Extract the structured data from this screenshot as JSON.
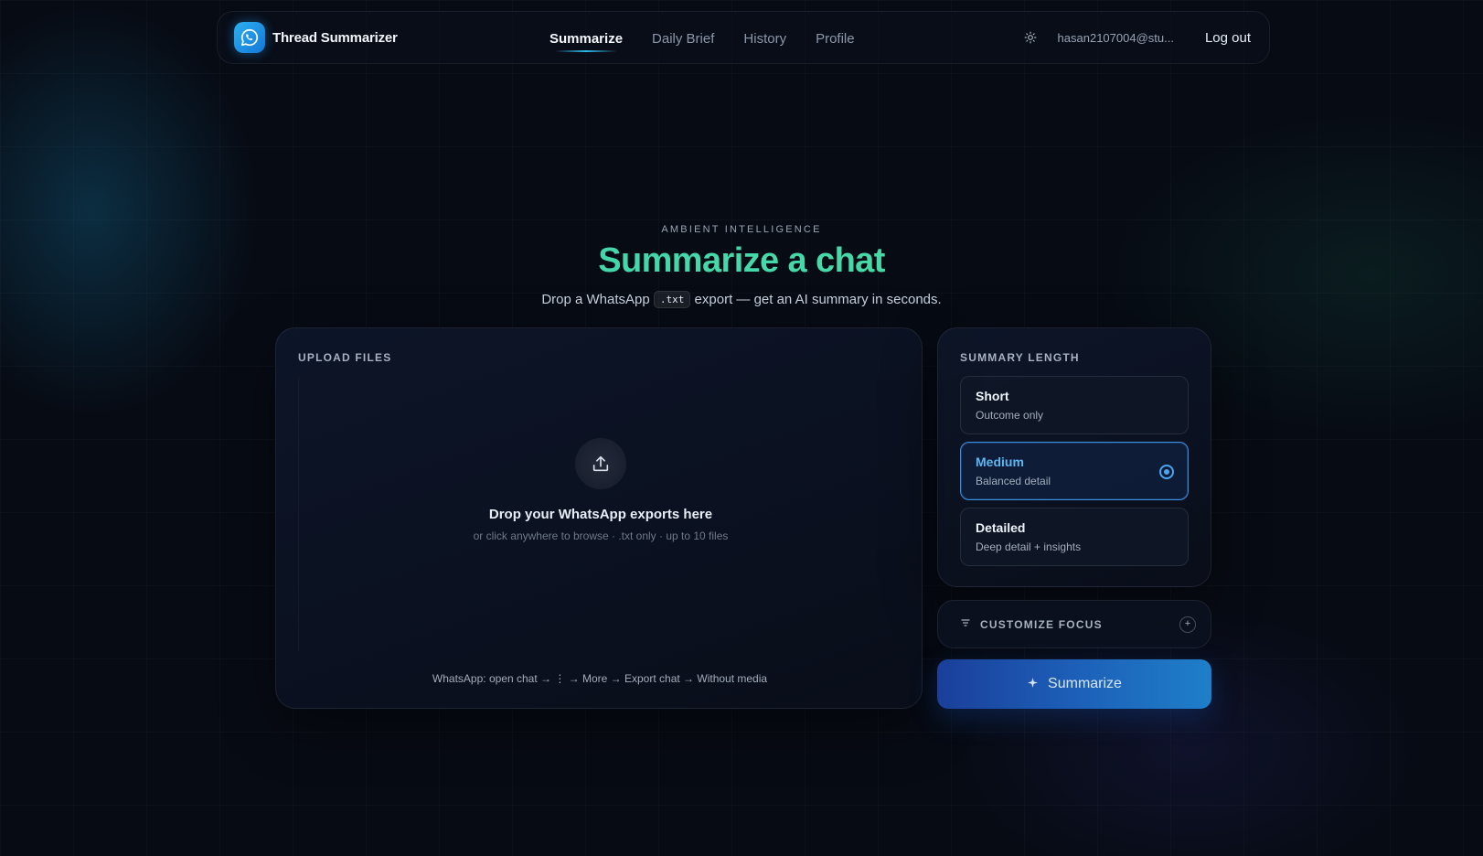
{
  "app": {
    "name": "Thread Summarizer"
  },
  "nav": {
    "links": [
      {
        "label": "Summarize",
        "active": true
      },
      {
        "label": "Daily Brief",
        "active": false
      },
      {
        "label": "History",
        "active": false
      },
      {
        "label": "Profile",
        "active": false
      }
    ],
    "user_email": "hasan2107004@stu...",
    "logout_label": "Log out"
  },
  "hero": {
    "eyebrow": "AMBIENT INTELLIGENCE",
    "title": "Summarize a chat",
    "subtitle_before": "Drop a WhatsApp",
    "subtitle_code": ".txt",
    "subtitle_after": "export — get an AI summary in seconds."
  },
  "upload": {
    "section_label": "UPLOAD FILES",
    "drop_title": "Drop your WhatsApp exports here",
    "drop_subtitle": "or click anywhere to browse · .txt only · up to 10 files",
    "hint": "WhatsApp: open chat → ⋮ → More → Export chat → Without media"
  },
  "summary_length": {
    "section_label": "SUMMARY LENGTH",
    "options": [
      {
        "title": "Short",
        "description": "Outcome only",
        "selected": false
      },
      {
        "title": "Medium",
        "description": "Balanced detail",
        "selected": true
      },
      {
        "title": "Detailed",
        "description": "Deep detail + insights",
        "selected": false
      }
    ]
  },
  "customize_focus": {
    "label": "CUSTOMIZE FOCUS",
    "plus": "+"
  },
  "summarize_button": {
    "label": "Summarize"
  },
  "colors": {
    "accent_blue": "#4aa6ee",
    "title_green": "#3fd0b0",
    "background": "#070b14"
  },
  "icons": {
    "logo": "whatsapp-icon",
    "theme": "sun-icon",
    "upload": "upload-icon",
    "focus": "sliders-icon",
    "summarize": "sparkle-icon"
  }
}
